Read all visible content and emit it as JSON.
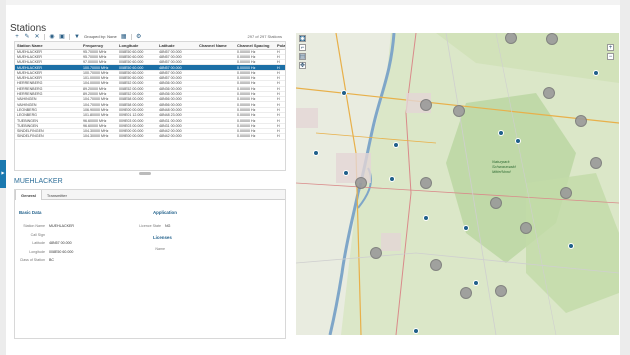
{
  "panel": {
    "title": "Stations"
  },
  "toolbar": {
    "group_label": "Grouped by: None",
    "count_label": "297 of 297 Stations"
  },
  "table": {
    "columns": [
      "Station Name",
      "Frequency",
      "Longitude",
      "Latitude",
      "Channel Name",
      "Channel Spacing",
      "Pola"
    ],
    "rows": [
      [
        "MUEHLACKER",
        "95.70000 MHz",
        "008E50 60.000",
        "48N57 00.000",
        "",
        "0.00000 Hz",
        "H"
      ],
      [
        "MUEHLACKER",
        "95.70000 MHz",
        "008E50 60.000",
        "48N57 00.000",
        "",
        "0.00000 Hz",
        "H"
      ],
      [
        "MUEHLACKER",
        "97.00000 MHz",
        "008E50 60.000",
        "48N57 00.000",
        "",
        "0.00000 Hz",
        "H"
      ],
      [
        "MUEHLACKER",
        "100.70000 MHz",
        "008E50 60.000",
        "48N57 00.000",
        "",
        "0.00000 Hz",
        "H"
      ],
      [
        "MUEHLACKER",
        "100.70000 MHz",
        "008E50 60.000",
        "48N57 00.000",
        "",
        "0.00000 Hz",
        "H"
      ],
      [
        "MUEHLACKER",
        "101.00000 MHz",
        "008E50 60.000",
        "48N57 00.000",
        "",
        "0.00000 Hz",
        "H"
      ],
      [
        "HERRENBERG",
        "104.00000 MHz",
        "008E52 00.000",
        "48N36 00.000",
        "",
        "0.00000 Hz",
        "H"
      ],
      [
        "HERRENBERG",
        "89.20000 MHz",
        "008E52 00.000",
        "48N36 00.000",
        "",
        "0.00000 Hz",
        "H"
      ],
      [
        "HERRENBERG",
        "89.20000 MHz",
        "008E52 00.000",
        "48N36 00.000",
        "",
        "0.00000 Hz",
        "H"
      ],
      [
        "VAIHINGEN",
        "104.70000 MHz",
        "008E58 00.000",
        "48N56 00.000",
        "",
        "0.00000 Hz",
        "H"
      ],
      [
        "VAIHINGEN",
        "104.70000 MHz",
        "008E58 00.000",
        "48N56 00.000",
        "",
        "0.00000 Hz",
        "H"
      ],
      [
        "LEONBERG",
        "106.90000 MHz",
        "009E00 00.000",
        "48N48 00.000",
        "",
        "0.00000 Hz",
        "H"
      ],
      [
        "LEONBERG",
        "101.80000 MHz",
        "009E01 12.000",
        "48N48 23.000",
        "",
        "0.00000 Hz",
        "H"
      ],
      [
        "TUEBINGEN",
        "96.60000 MHz",
        "009E03 00.000",
        "48N31 00.000",
        "",
        "0.00000 Hz",
        "H"
      ],
      [
        "TUEBINGEN",
        "96.60000 MHz",
        "009E03 00.000",
        "48N31 00.000",
        "",
        "0.00000 Hz",
        "H"
      ],
      [
        "SINDELFINGEN",
        "104.30000 MHz",
        "009E00 00.000",
        "48N42 00.000",
        "",
        "0.00000 Hz",
        "H"
      ],
      [
        "SINDELFINGEN",
        "104.30000 MHz",
        "009E00 00.000",
        "48N42 00.000",
        "",
        "0.00000 Hz",
        "H"
      ]
    ],
    "selected_index": 3
  },
  "detail": {
    "title": "MUEHLACKER",
    "tabs": [
      "General",
      "Transmitter"
    ],
    "basic_title": "Basic Data",
    "application_title": "Application",
    "licenses_title": "Licenses",
    "fields": [
      {
        "label": "Station Name",
        "value": "MUEHLACKER"
      },
      {
        "label": "Call Sign",
        "value": ""
      },
      {
        "label": "Latitude",
        "value": "48N57 00.000"
      },
      {
        "label": "Longitude",
        "value": "008E50 60.000"
      },
      {
        "label": "Class of Station",
        "value": "BC"
      }
    ],
    "licence_state_label": "Licence State",
    "licence_state_value": "NG",
    "name_col": "Name"
  },
  "map": {
    "region_label_1": "Naturpark",
    "region_label_2": "Schwarzwald",
    "region_label_3": "Mitte/Nord"
  }
}
